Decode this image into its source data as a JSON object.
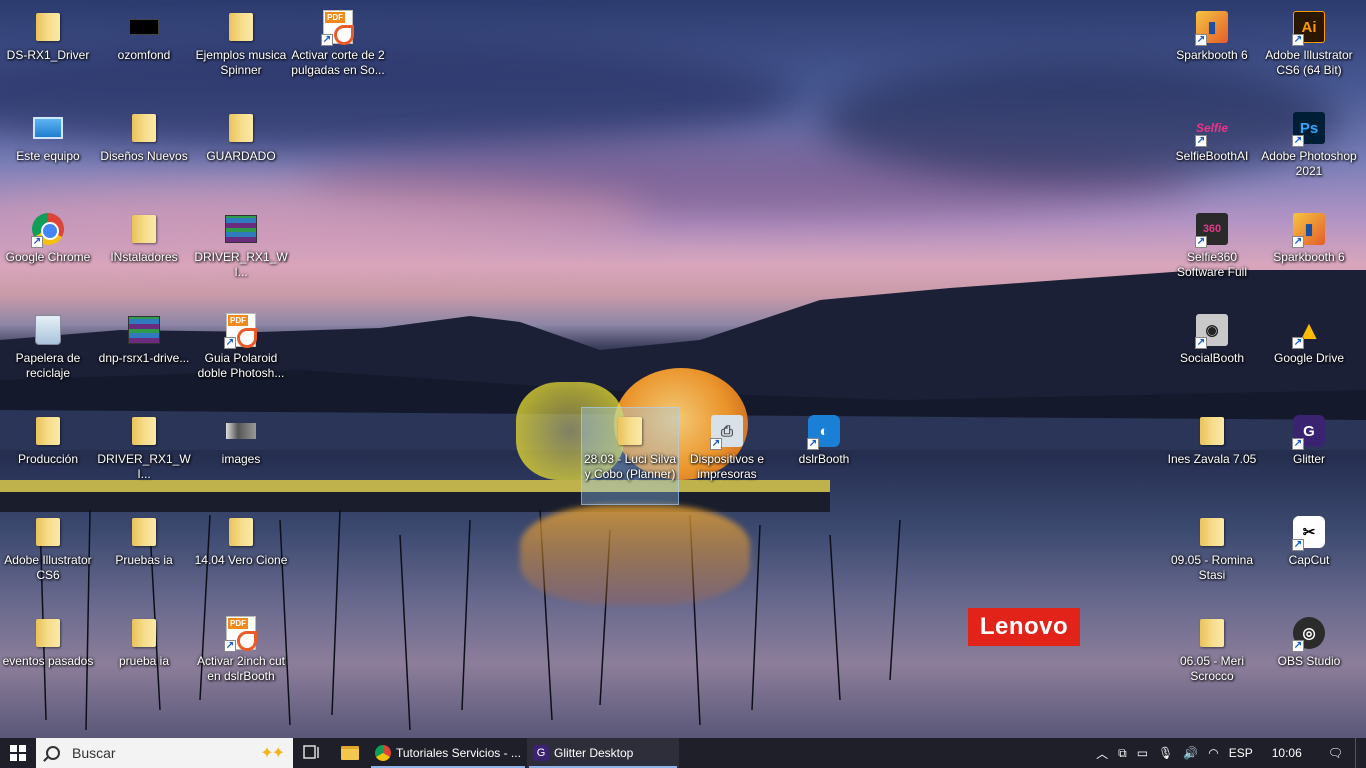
{
  "desktop": {
    "icons": [
      {
        "id": "ds-rx1-driver",
        "label": "DS-RX1_Driver",
        "type": "folder"
      },
      {
        "id": "ozomfond",
        "label": "ozomfond",
        "type": "image"
      },
      {
        "id": "ejemplos-musica",
        "label": "Ejemplos musica Spinner",
        "type": "folder"
      },
      {
        "id": "activar-corte",
        "label": "Activar corte de 2 pulgadas en So...",
        "type": "pdf"
      },
      {
        "id": "este-equipo",
        "label": "Este equipo",
        "type": "pc"
      },
      {
        "id": "disenos-nuevos",
        "label": "Diseños Nuevos",
        "type": "folder"
      },
      {
        "id": "guardado",
        "label": "GUARDADO",
        "type": "folder"
      },
      {
        "id": "google-chrome",
        "label": "Google Chrome",
        "type": "chrome"
      },
      {
        "id": "instaladores",
        "label": "INstaladores",
        "type": "folder"
      },
      {
        "id": "driver-rx1-wi-1",
        "label": "DRIVER_RX1_WI...",
        "type": "rar"
      },
      {
        "id": "papelera",
        "label": "Papelera de reciclaje",
        "type": "trash"
      },
      {
        "id": "dnp-rsrx1",
        "label": "dnp-rsrx1-drive...",
        "type": "rar"
      },
      {
        "id": "guia-polaroid",
        "label": "Guia Polaroid doble Photosh...",
        "type": "pdf"
      },
      {
        "id": "produccion",
        "label": "Producción",
        "type": "folder"
      },
      {
        "id": "driver-rx1-wi-2",
        "label": "DRIVER_RX1_WI...",
        "type": "folder"
      },
      {
        "id": "images",
        "label": "images",
        "type": "photo"
      },
      {
        "id": "luci-silva",
        "label": "28.03 - Luci Silva y Cobo (Planner)",
        "type": "folder"
      },
      {
        "id": "dispositivos",
        "label": "Dispositivos e impresoras",
        "type": "devices"
      },
      {
        "id": "dslrbooth",
        "label": "dslrBooth",
        "type": "dslr"
      },
      {
        "id": "adobe-illustrator-cs6",
        "label": "Adobe Illustrator CS6",
        "type": "folder"
      },
      {
        "id": "pruebas-ia",
        "label": "Pruebas ia",
        "type": "folder"
      },
      {
        "id": "vero-cione",
        "label": "14.04 Vero Cione",
        "type": "folder"
      },
      {
        "id": "eventos-pasados",
        "label": "eventos pasados",
        "type": "folder"
      },
      {
        "id": "prueba-ia",
        "label": "prueba ia",
        "type": "folder"
      },
      {
        "id": "activar-2inch",
        "label": "Activar 2inch cut en dslrBooth",
        "type": "pdf"
      },
      {
        "id": "sparkbooth-6-a",
        "label": "Sparkbooth 6",
        "type": "sparkbooth"
      },
      {
        "id": "adobe-illustrator-64",
        "label": "Adobe Illustrator CS6 (64 Bit)",
        "type": "ai"
      },
      {
        "id": "selfieboothai",
        "label": "SelfieBoothAI",
        "type": "selfie"
      },
      {
        "id": "adobe-photoshop",
        "label": "Adobe Photoshop 2021",
        "type": "ps"
      },
      {
        "id": "selfie360",
        "label": "Selfie360 Software Full",
        "type": "s360"
      },
      {
        "id": "sparkbooth-6-b",
        "label": "Sparkbooth 6",
        "type": "sparkbooth"
      },
      {
        "id": "socialbooth",
        "label": "SocialBooth",
        "type": "camera"
      },
      {
        "id": "google-drive",
        "label": "Google Drive",
        "type": "gdrive"
      },
      {
        "id": "ines-zavala",
        "label": "Ines Zavala 7.05",
        "type": "folder"
      },
      {
        "id": "glitter",
        "label": "Glitter",
        "type": "glitter"
      },
      {
        "id": "romina-stasi",
        "label": "09.05 - Romina Stasi",
        "type": "folder"
      },
      {
        "id": "capcut",
        "label": "CapCut",
        "type": "capcut"
      },
      {
        "id": "meri-scrocco",
        "label": "06.05 - Meri Scrocco",
        "type": "folder"
      },
      {
        "id": "obs-studio",
        "label": "OBS Studio",
        "type": "obs"
      }
    ],
    "wallpaper_brand": "Lenovo"
  },
  "taskbar": {
    "search_placeholder": "Buscar",
    "apps": [
      {
        "label": "Tutoriales Servicios - ...",
        "icon": "chrome-icon"
      },
      {
        "label": "Glitter Desktop",
        "icon": "glitter-icon"
      }
    ],
    "tray": {
      "language": "ESP",
      "time": "10:06"
    }
  },
  "colors": {
    "taskbar_bg": "#1f1f2a",
    "lenovo_red": "#e2231a",
    "selection": "#99ccff"
  }
}
